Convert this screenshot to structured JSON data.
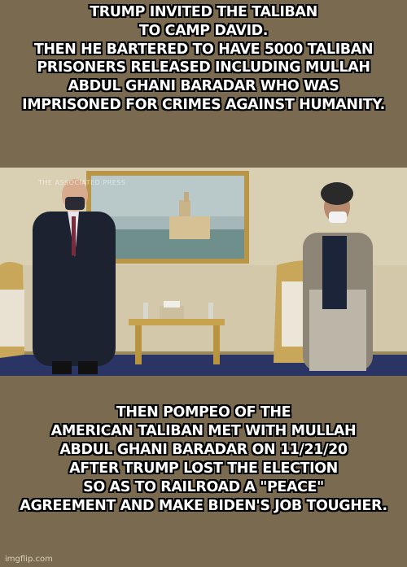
{
  "meme": {
    "top_lines": [
      "TRUMP INVITED THE TALIBAN",
      "TO CAMP DAVID.",
      "THEN HE BARTERED TO HAVE 5000 TALIBAN",
      "PRISONERS RELEASED INCLUDING MULLAH",
      "ABDUL GHANI BARADAR WHO WAS",
      "IMPRISONED FOR CRIMES AGAINST HUMANITY."
    ],
    "bottom_lines": [
      "THEN POMPEO OF THE",
      "AMERICAN TALIBAN MET WITH MULLAH",
      "ABDUL GHANI BARADAR ON 11/21/20",
      "AFTER TRUMP LOST THE ELECTION",
      "SO AS TO RAILROAD A \"PEACE\"",
      "AGREEMENT AND MAKE BIDEN'S JOB TOUGHER."
    ],
    "photo_watermark": "THE ASSOCIATED PRESS",
    "site_watermark": "imgflip.com"
  },
  "colors": {
    "background": "#7a6a4f",
    "caption_text": "#ffffff",
    "caption_outline": "#000000"
  }
}
